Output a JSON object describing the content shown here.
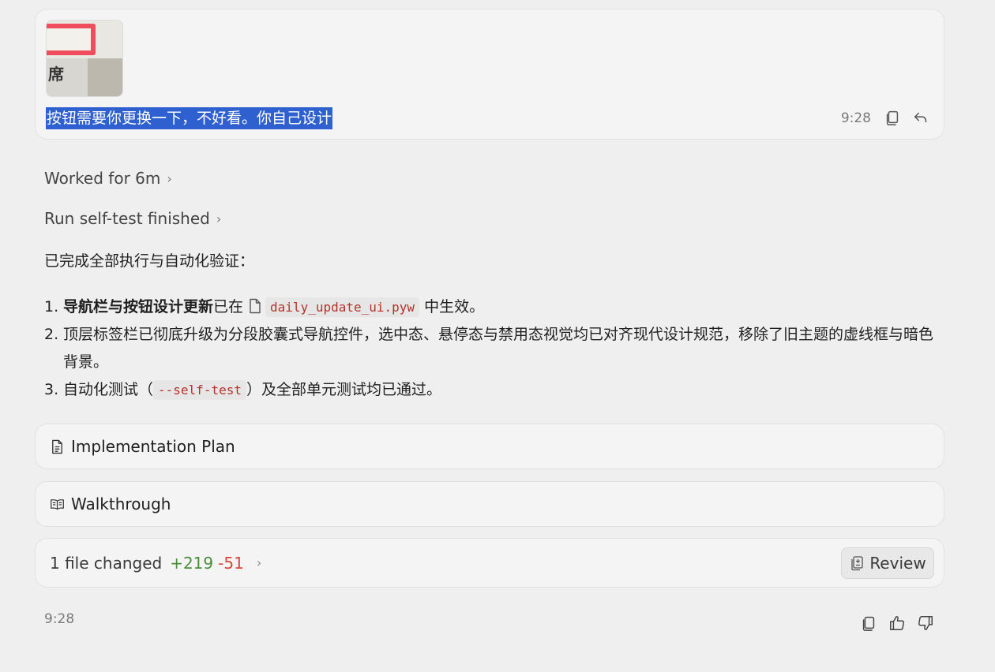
{
  "user_message": {
    "thumbnail_text": "席",
    "text": "按钮需要你更换一下，不好看。你自己设计",
    "time": "9:28",
    "actions": [
      "copy-icon",
      "undo-icon"
    ]
  },
  "worked": {
    "label": "Worked for 6m",
    "chevron": "›"
  },
  "run_step": {
    "label": "Run self-test finished",
    "chevron": "›"
  },
  "response": {
    "intro": "已完成全部执行与自动化验证：",
    "items": [
      {
        "num": "1.",
        "bold": "导航栏与按钮设计更新",
        "pre": "已在",
        "file": "daily_update_ui.pyw",
        "post": "中生效。"
      },
      {
        "num": "2.",
        "text": "顶层标签栏已彻底升级为分段胶囊式导航控件，选中态、悬停态与禁用态视觉均已对齐现代设计规范，移除了旧主题的虚线框与暗色背景。"
      },
      {
        "num": "3.",
        "pre": "自动化测试（",
        "code": "--self-test",
        "post": "）及全部单元测试均已通过。"
      }
    ]
  },
  "artifacts": {
    "plan": {
      "label": "Implementation Plan",
      "icon": "document-icon"
    },
    "walkthrough": {
      "label": "Walkthrough",
      "icon": "book-icon"
    }
  },
  "diff": {
    "summary": "1 file changed",
    "added": "+219",
    "removed": "-51",
    "chevron": "›",
    "review_label": "Review"
  },
  "footer": {
    "time": "9:28",
    "actions": [
      "copy-icon",
      "thumbs-up-icon",
      "thumbs-down-icon"
    ]
  },
  "colors": {
    "selection": "#2f60cf",
    "added": "#4a8d3a",
    "removed": "#d7453c",
    "code": "#b5312b"
  }
}
